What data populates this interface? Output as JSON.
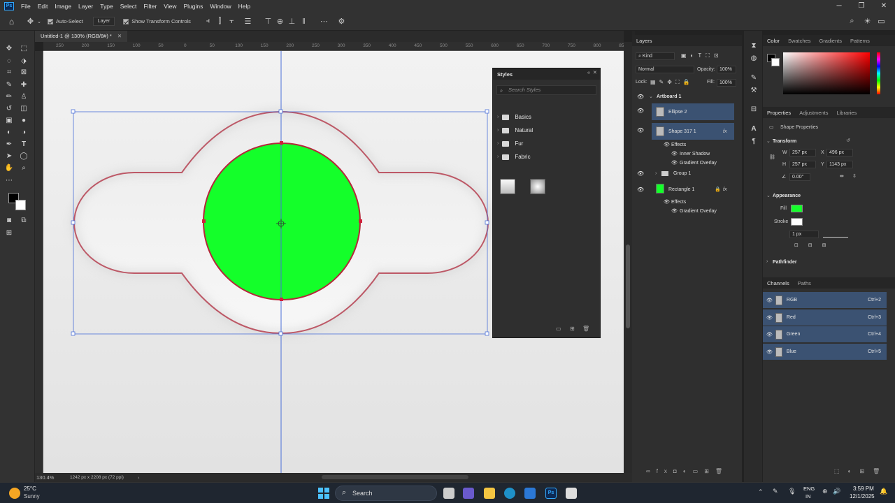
{
  "menu": [
    "File",
    "Edit",
    "Image",
    "Layer",
    "Type",
    "Select",
    "Filter",
    "View",
    "Plugins",
    "Window",
    "Help"
  ],
  "app_logo": "Ps",
  "options": {
    "auto_select": "Auto-Select",
    "layer_dropdown": "Layer",
    "show_transform": "Show Transform Controls"
  },
  "document": {
    "tab_title": "Untitled-1 @ 130% (RGB/8#) *",
    "zoom": "130.4%",
    "dims": "1242 px x 2208 px (72 ppi)"
  },
  "ruler_ticks": [
    "250",
    "200",
    "150",
    "100",
    "50",
    "0",
    "50",
    "100",
    "150",
    "200",
    "250",
    "300",
    "350",
    "400",
    "450",
    "500",
    "550",
    "600",
    "650",
    "700",
    "750",
    "800",
    "850"
  ],
  "canvas_colors": {
    "fill": "#14ff2a",
    "stroke": "#b5263a",
    "guide": "#4a6fd8"
  },
  "styles_panel": {
    "title": "Styles",
    "search_placeholder": "Search Styles",
    "folders": [
      "Basics",
      "Natural",
      "Fur",
      "Fabric"
    ]
  },
  "layers_panel": {
    "tabs": [
      "Layers"
    ],
    "kind": "Kind",
    "blend": "Normal",
    "opacity_label": "Opacity:",
    "opacity": "100%",
    "lock_label": "Lock:",
    "fill_label": "Fill:",
    "fill": "100%",
    "rows": [
      {
        "name": "Artboard 1"
      },
      {
        "name": "Ellipse 2"
      },
      {
        "name": "Shape 317 1"
      },
      {
        "name": "Effects"
      },
      {
        "name": "Inner Shadow"
      },
      {
        "name": "Gradient Overlay"
      },
      {
        "name": "Group 1"
      },
      {
        "name": "Rectangle 1"
      },
      {
        "name": "Effects"
      },
      {
        "name": "Gradient Overlay"
      }
    ],
    "fx": "fx"
  },
  "color_panel": {
    "tabs": [
      "Color",
      "Swatches",
      "Gradients",
      "Patterns"
    ]
  },
  "properties_panel": {
    "tabs": [
      "Properties",
      "Adjustments",
      "Libraries"
    ],
    "subtitle": "Shape Properties",
    "transform": "Transform",
    "w_label": "W",
    "w": "257 px",
    "x_label": "X",
    "x": "496 px",
    "h_label": "H",
    "h": "257 px",
    "y_label": "Y",
    "y": "1143 px",
    "angle": "0.00°",
    "appearance": "Appearance",
    "fill_label": "Fill",
    "stroke_label": "Stroke",
    "stroke_size": "1 px",
    "pathfinder": "Pathfinder"
  },
  "channels_panel": {
    "tabs": [
      "Channels",
      "Paths"
    ],
    "rows": [
      {
        "name": "RGB",
        "shortcut": "Ctrl+2"
      },
      {
        "name": "Red",
        "shortcut": "Ctrl+3"
      },
      {
        "name": "Green",
        "shortcut": "Ctrl+4"
      },
      {
        "name": "Blue",
        "shortcut": "Ctrl+5"
      }
    ]
  },
  "taskbar": {
    "weather_temp": "25°C",
    "weather_desc": "Sunny",
    "search": "Search",
    "lang1": "ENG",
    "lang2": "IN",
    "time": "3:59 PM",
    "date": "12/1/2025"
  }
}
